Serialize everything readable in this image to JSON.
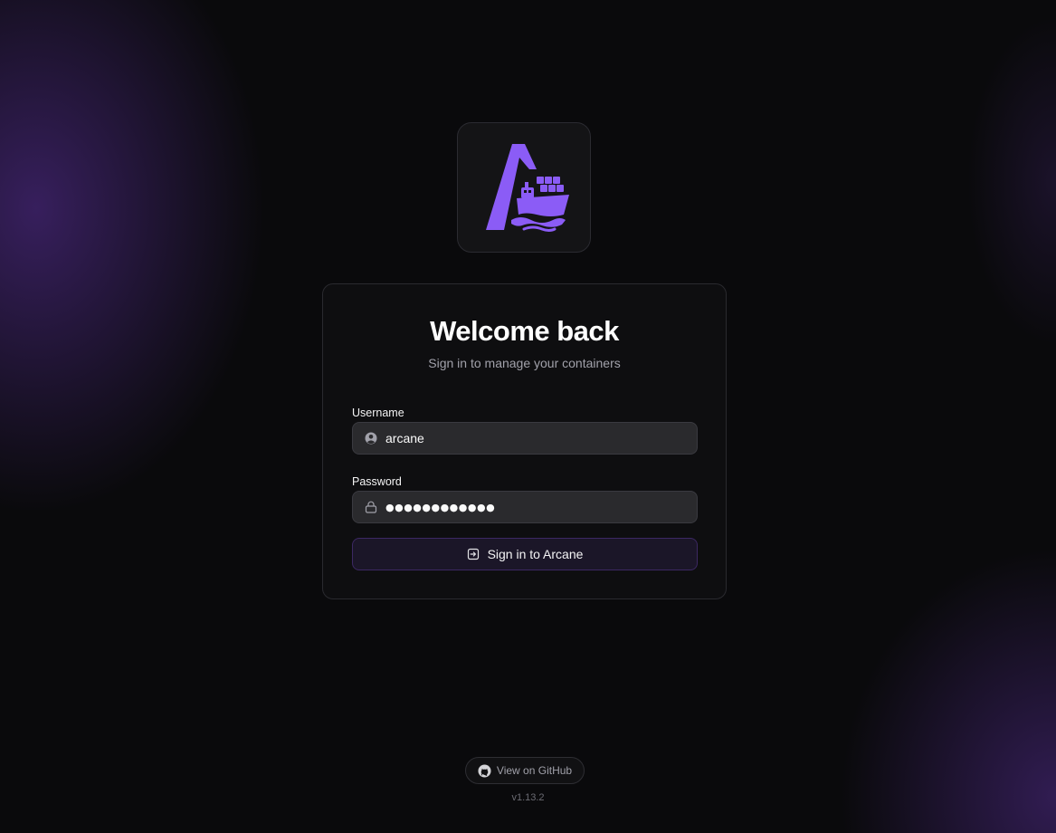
{
  "app": {
    "logo_icon": "arcane-ship-logo-icon",
    "accent_color": "#8b5cf6"
  },
  "card": {
    "title": "Welcome back",
    "subtitle": "Sign in to manage your containers"
  },
  "form": {
    "username": {
      "label": "Username",
      "value": "arcane",
      "icon": "user-circle-icon"
    },
    "password": {
      "label": "Password",
      "value": "●●●●●●●●●●●●",
      "icon": "lock-icon"
    },
    "submit": {
      "label": "Sign in to Arcane",
      "icon": "login-icon"
    }
  },
  "footer": {
    "github_label": "View on GitHub",
    "github_icon": "github-icon",
    "version": "v1.13.2"
  }
}
